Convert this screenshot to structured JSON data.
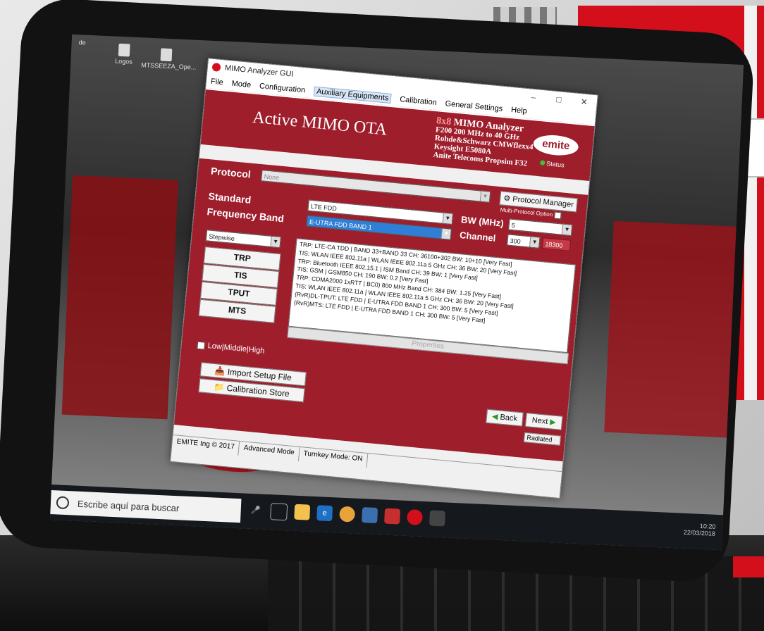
{
  "desktop": {
    "icons": [
      {
        "label": "Logos"
      },
      {
        "label": "MTSSEEZA_Ope..."
      },
      {
        "label": "de"
      }
    ],
    "taskbar": {
      "search_placeholder": "Escribe aquí para buscar",
      "time": "10:20",
      "date": "22/03/2018"
    }
  },
  "window": {
    "title": "MIMO Analyzer GUI",
    "menu": [
      "File",
      "Mode",
      "Configuration",
      "Auxiliary Equipments",
      "Calibration",
      "General Settings",
      "Help"
    ],
    "selected_menu": "Auxiliary Equipments",
    "banner": {
      "app_title": "Active MIMO OTA",
      "matrix": "8x8",
      "product": "MIMO Analyzer",
      "spec_lines": [
        "F200 200 MHz to 40 GHz",
        "Rohde&Schwarz CMWflexx4",
        "Keysight E5080A",
        "Anite Telecoms Propsim F32"
      ],
      "brand": "emite",
      "status_label": "Status"
    },
    "protocol": {
      "label": "Protocol",
      "value": "None",
      "manager_button": "Protocol Manager",
      "multi_protocol_label": "Multi-Protocol Option"
    },
    "standard": {
      "label": "Standard",
      "value": "LTE FDD"
    },
    "frequency_band": {
      "label": "Frequency Band",
      "value": "E-UTRA FDD BAND 1"
    },
    "bw": {
      "label": "BW (MHz)",
      "value": "5"
    },
    "channel": {
      "label": "Channel",
      "value": "300",
      "readout": "18300"
    },
    "measurement_mode": "Stepwise",
    "measure_buttons": [
      "TRP",
      "TIS",
      "TPUT",
      "MTS"
    ],
    "test_list": [
      "TRP: LTE-CA TDD | BAND 33+BAND 33 CH: 36100+302 BW: 10+10 [Very Fast]",
      "TIS: WLAN IEEE 802.11a | WLAN IEEE 802.11a 5 GHz CH: 36 BW: 20 [Very Fast]",
      "TRP: Bluetooth IEEE 802.15.1 | ISM Band CH: 39 BW: 1 [Very Fast]",
      "TIS: GSM | GSM850 CH: 190 BW: 0.2 [Very Fast]",
      "TRP: CDMA2000 1xRTT | BC0) 800 MHz Band CH: 384 BW: 1.25 [Very Fast]",
      "TIS: WLAN IEEE 802.11a | WLAN IEEE 802.11a 5 GHz CH: 36 BW: 20 [Very Fast]",
      "(RvR)DL-TPUT: LTE FDD | E-UTRA FDD BAND 1 CH: 300 BW: 5 [Very Fast]",
      "(RvR)MTS: LTE FDD | E-UTRA FDD BAND 1 CH: 300 BW: 5 [Very Fast]"
    ],
    "properties_label": "Properties",
    "low_middle_high": "Low|Middle|High",
    "import_button": "Import Setup File",
    "calibration_store_button": "Calibration Store",
    "back_button": "Back",
    "next_button": "Next",
    "radiated": "Radiated",
    "statusbar": {
      "copyright": "EMITE Ing © 2017",
      "mode": "Advanced Mode",
      "turnkey": "Turnkey Mode: ON"
    }
  },
  "colors": {
    "brand_red": "#9e1e2c",
    "selection_blue": "#2f7fd6",
    "wall_red": "#d40f1c"
  }
}
